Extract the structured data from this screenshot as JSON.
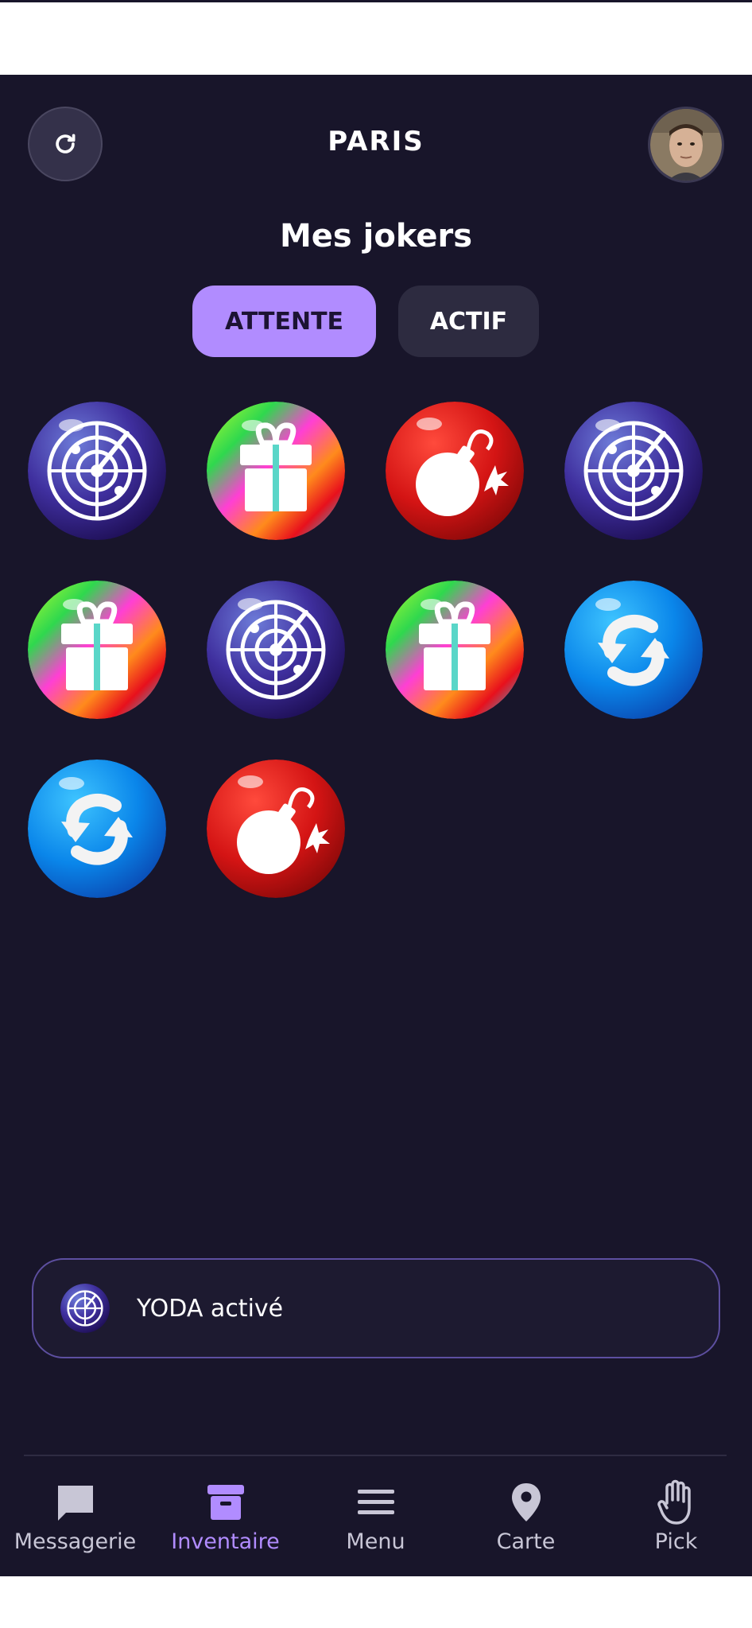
{
  "header": {
    "city": "PARIS"
  },
  "page": {
    "title": "Mes jokers"
  },
  "tabs": [
    {
      "label": "ATTENTE",
      "active": true
    },
    {
      "label": "ACTIF",
      "active": false
    }
  ],
  "jokers": [
    {
      "type": "radar",
      "row": 1,
      "col": 1
    },
    {
      "type": "gift",
      "row": 1,
      "col": 2
    },
    {
      "type": "bomb",
      "row": 1,
      "col": 3
    },
    {
      "type": "radar",
      "row": 1,
      "col": 4
    },
    {
      "type": "gift",
      "row": 2,
      "col": 1
    },
    {
      "type": "radar",
      "row": 2,
      "col": 2
    },
    {
      "type": "gift",
      "row": 2,
      "col": 3
    },
    {
      "type": "swap",
      "row": 2,
      "col": 4
    },
    {
      "type": "swap",
      "row": 3,
      "col": 1
    },
    {
      "type": "bomb",
      "row": 3,
      "col": 2
    }
  ],
  "notification": {
    "text": "YODA activé",
    "icon": "radar-icon"
  },
  "nav": [
    {
      "label": "Messagerie",
      "icon": "chat-icon"
    },
    {
      "label": "Inventaire",
      "icon": "archive-icon",
      "active": true
    },
    {
      "label": "Menu",
      "icon": "menu-icon"
    },
    {
      "label": "Carte",
      "icon": "map-pin-icon"
    },
    {
      "label": "Pick",
      "icon": "hand-icon"
    }
  ],
  "colors": {
    "background": "#18152a",
    "accent": "#b18cff",
    "tab_inactive": "#2d2b40"
  }
}
